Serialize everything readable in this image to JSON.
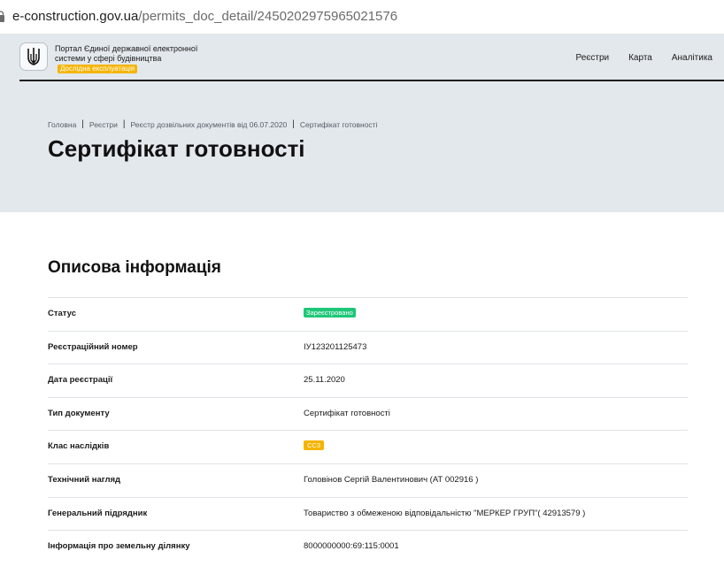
{
  "browser": {
    "url_domain": "e-construction.gov.ua",
    "url_path": "/permits_doc_detail/2450202975965021576"
  },
  "header": {
    "emblem_icon": "trident-icon",
    "portal_title": "Портал Єдиної державної електронної системи у сфері будівництва",
    "beta_label": "Дослідна експлуатація",
    "nav": [
      "Реєстри",
      "Карта",
      "Аналітика"
    ]
  },
  "breadcrumb": [
    "Головна",
    "Реєстри",
    "Реєстр дозвільних документів від 06.07.2020",
    "Сертифікат готовності"
  ],
  "page_title": "Сертифікат готовності",
  "section_title": "Описова інформація",
  "rows": [
    {
      "label": "Статус",
      "value": "Зареєстровано"
    },
    {
      "label": "Реєстраційний номер",
      "value": "IУ123201125473"
    },
    {
      "label": "Дата реєстрації",
      "value": "25.11.2020"
    },
    {
      "label": "Тип документу",
      "value": "Сертифікат готовності"
    },
    {
      "label": "Клас наслідків",
      "value": "СС3"
    },
    {
      "label": "Технічний нагляд",
      "value": "Головінов Сергій Валентинович (АТ 002916 )"
    },
    {
      "label": "Генеральний підрядник",
      "value": "Товариство з обмеженою відповідальністю \"МЕРКЕР ГРУП\"( 42913579 )"
    },
    {
      "label": "Інформація про земельну ділянку",
      "value": "8000000000:69:115:0001"
    }
  ],
  "colors": {
    "header_bg": "#e3e8ed",
    "status_green": "#1ec778",
    "accent_yellow": "#f5b400"
  }
}
